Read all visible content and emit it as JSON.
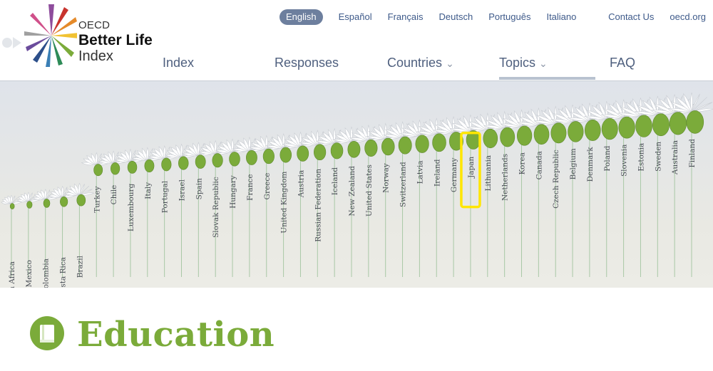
{
  "logo": {
    "line1": "OECD",
    "line2": "Better Life",
    "line3": "Index"
  },
  "languages": [
    "English",
    "Español",
    "Français",
    "Deutsch",
    "Português",
    "Italiano"
  ],
  "top_links": [
    "Contact Us",
    "oecd.org"
  ],
  "nav": {
    "index": "Index",
    "responses": "Responses",
    "countries": "Countries",
    "topics": "Topics",
    "faq": "FAQ"
  },
  "nav_arrow": "⌄",
  "countries": [
    "South Africa",
    "Mexico",
    "Colombia",
    "Costa Rica",
    "Brazil",
    "Turkey",
    "Chile",
    "Luxembourg",
    "Italy",
    "Portugal",
    "Israel",
    "Spain",
    "Slovak Republic",
    "Hungary",
    "France",
    "Greece",
    "United Kingdom",
    "Austria",
    "Russian Federation",
    "Iceland",
    "New Zealand",
    "United States",
    "Norway",
    "Switzerland",
    "Latvia",
    "Ireland",
    "Germany",
    "Japan",
    "Lithuania",
    "Netherlands",
    "Korea",
    "Canada",
    "Czech Republic",
    "Belgium",
    "Denmark",
    "Poland",
    "Slovenia",
    "Estonia",
    "Sweden",
    "Australia",
    "Finland"
  ],
  "highlighted_country": "Japan",
  "colors": {
    "accent_green": "#7bab3a",
    "highlight": "#ffe600",
    "nav_blue": "#3e5a8a"
  },
  "section": {
    "title": "Education",
    "icon": "book-icon"
  }
}
